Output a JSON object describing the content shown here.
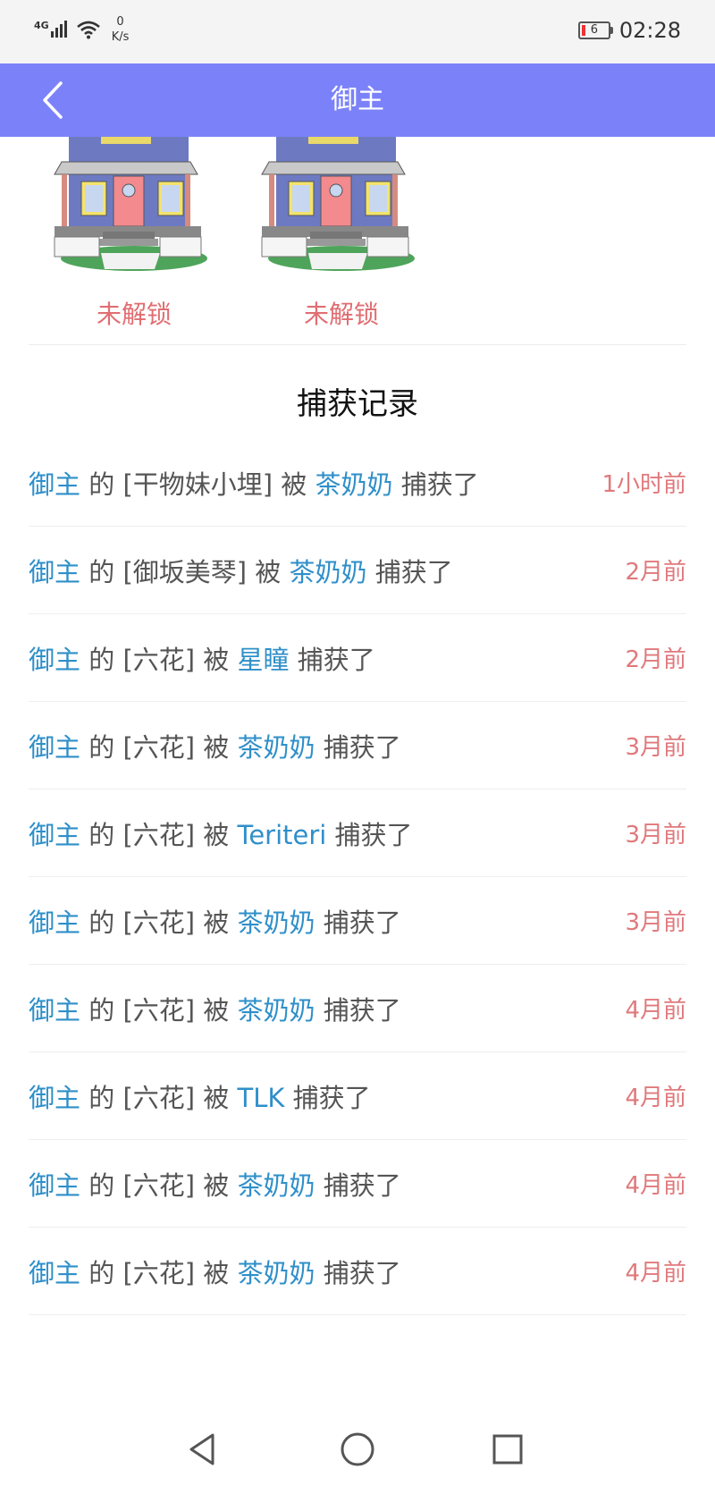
{
  "status_bar": {
    "network": "4G",
    "speed_value": "0",
    "speed_unit": "K/s",
    "battery": "6",
    "time": "02:28"
  },
  "nav": {
    "title": "御主",
    "back_icon": "chevron-left-icon",
    "bar_color": "#7b82f9"
  },
  "houses": [
    {
      "label": "未解锁",
      "icon": "house-icon"
    },
    {
      "label": "未解锁",
      "icon": "house-icon"
    }
  ],
  "section_title": "捕获记录",
  "records": [
    {
      "owner": "御主",
      "of": " 的 ",
      "item": "[干物妹小埋]",
      "by": " 被 ",
      "catcher": "茶奶奶",
      "action": " 捕获了",
      "time": "1小时前"
    },
    {
      "owner": "御主",
      "of": " 的 ",
      "item": "[御坂美琴]",
      "by": " 被 ",
      "catcher": "茶奶奶",
      "action": " 捕获了",
      "time": "2月前"
    },
    {
      "owner": "御主",
      "of": " 的 ",
      "item": "[六花]",
      "by": " 被 ",
      "catcher": "星瞳",
      "action": " 捕获了",
      "time": "2月前"
    },
    {
      "owner": "御主",
      "of": " 的 ",
      "item": "[六花]",
      "by": " 被 ",
      "catcher": "茶奶奶",
      "action": " 捕获了",
      "time": "3月前"
    },
    {
      "owner": "御主",
      "of": " 的 ",
      "item": "[六花]",
      "by": " 被 ",
      "catcher": "Teriteri",
      "action": " 捕获了",
      "time": "3月前"
    },
    {
      "owner": "御主",
      "of": " 的 ",
      "item": "[六花]",
      "by": " 被 ",
      "catcher": "茶奶奶",
      "action": " 捕获了",
      "time": "3月前"
    },
    {
      "owner": "御主",
      "of": " 的 ",
      "item": "[六花]",
      "by": " 被 ",
      "catcher": "茶奶奶",
      "action": " 捕获了",
      "time": "4月前"
    },
    {
      "owner": "御主",
      "of": " 的 ",
      "item": "[六花]",
      "by": " 被 ",
      "catcher": "TLK",
      "action": " 捕获了",
      "time": "4月前"
    },
    {
      "owner": "御主",
      "of": " 的 ",
      "item": "[六花]",
      "by": " 被 ",
      "catcher": "茶奶奶",
      "action": " 捕获了",
      "time": "4月前"
    },
    {
      "owner": "御主",
      "of": " 的 ",
      "item": "[六花]",
      "by": " 被 ",
      "catcher": "茶奶奶",
      "action": " 捕获了",
      "time": "4月前"
    }
  ],
  "colors": {
    "link_blue": "#2f8fc9",
    "time_red": "#e0797c",
    "locked_red": "#e06e72"
  },
  "bottom_nav": [
    "back-triangle-icon",
    "home-circle-icon",
    "recents-square-icon"
  ]
}
